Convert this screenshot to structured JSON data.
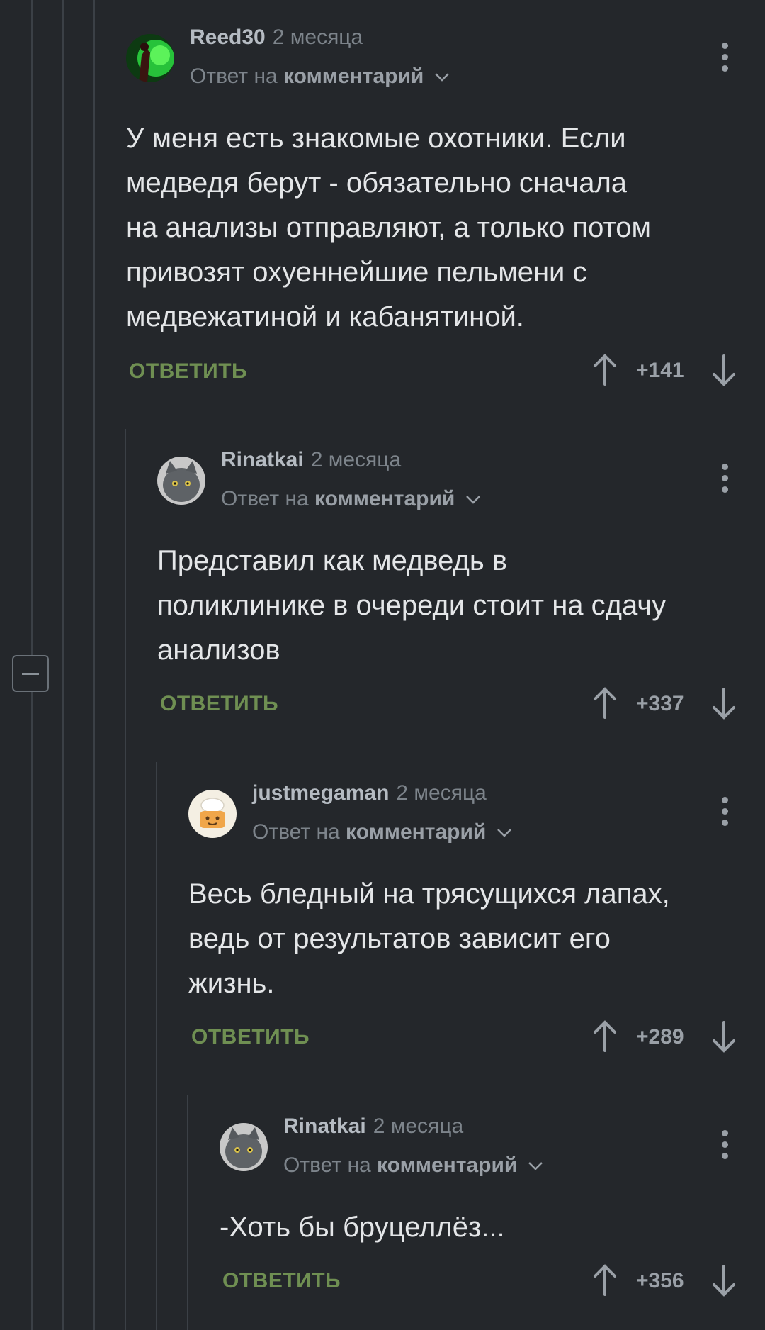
{
  "comments": [
    {
      "author": "Reed30",
      "time": "2 месяца",
      "reply_prefix": "Ответ на",
      "reply_link": "комментарий",
      "text_lines": [
        "У меня есть знакомые охотники. Если",
        "медведя берут - обязательно сначала",
        "на анализы отправляют, а только потом",
        "привозят охуеннейшие пельмени с",
        "медвежатиной и кабанятиной."
      ],
      "reply_label": "ОТВЕТИТЬ",
      "rating": "+141",
      "avatar_icon": "green-figure-avatar"
    },
    {
      "author": "Rinatkai",
      "time": "2 месяца",
      "reply_prefix": "Ответ на",
      "reply_link": "комментарий",
      "text_lines": [
        "Представил как медведь в",
        "поликлинике в очереди стоит на сдачу",
        "анализов"
      ],
      "reply_label": "ОТВЕТИТЬ",
      "rating": "+337",
      "avatar_icon": "grey-cat-avatar"
    },
    {
      "author": "justmegaman",
      "time": "2 месяца",
      "reply_prefix": "Ответ на",
      "reply_link": "комментарий",
      "text_lines": [
        "Весь бледный на трясущихся лапах,",
        "ведь от результатов зависит его",
        "жизнь."
      ],
      "reply_label": "ОТВЕТИТЬ",
      "rating": "+289",
      "avatar_icon": "chef-cake-avatar"
    },
    {
      "author": "Rinatkai",
      "time": "2 месяца",
      "reply_prefix": "Ответ на",
      "reply_link": "комментарий",
      "text_lines": [
        "-Хоть бы бруцеллёз..."
      ],
      "reply_label": "ОТВЕТИТЬ",
      "rating": "+356",
      "avatar_icon": "grey-cat-avatar"
    }
  ],
  "colors": {
    "background": "#24272b",
    "reply_green": "#6f8f52",
    "muted_text": "#7d848b",
    "tree_line": "#3b4046"
  }
}
